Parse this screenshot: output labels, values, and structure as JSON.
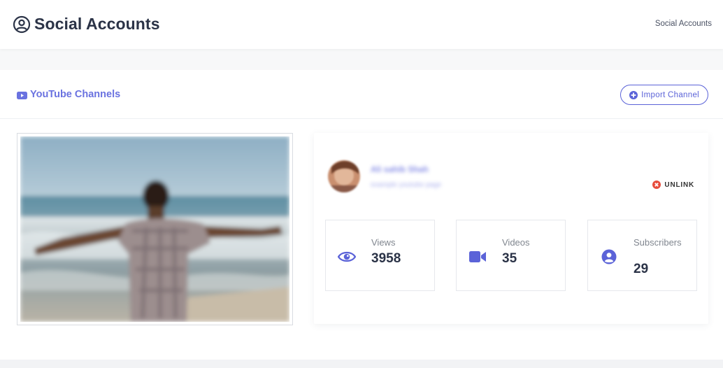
{
  "header": {
    "title": "Social Accounts",
    "breadcrumb": "Social Accounts",
    "title_icon": "user-circle-icon"
  },
  "section": {
    "title": "YouTube Channels",
    "title_icon": "youtube-icon",
    "import_label": "Import Channel",
    "import_icon": "plus-circle-icon"
  },
  "channel": {
    "name": "Ali sahib Shah",
    "subtitle": "example youtube page",
    "unlink_label": "UNLINK",
    "unlink_icon": "x-circle-icon",
    "stats": [
      {
        "label": "Views",
        "value": "3958",
        "icon": "eye-icon"
      },
      {
        "label": "Videos",
        "value": "35",
        "icon": "video-camera-icon"
      },
      {
        "label": "Subscribers",
        "value": "29",
        "icon": "user-circle-icon"
      }
    ]
  },
  "colors": {
    "accent": "#5b63d8",
    "danger": "#e74c3c",
    "text_dark": "#2b3347"
  }
}
